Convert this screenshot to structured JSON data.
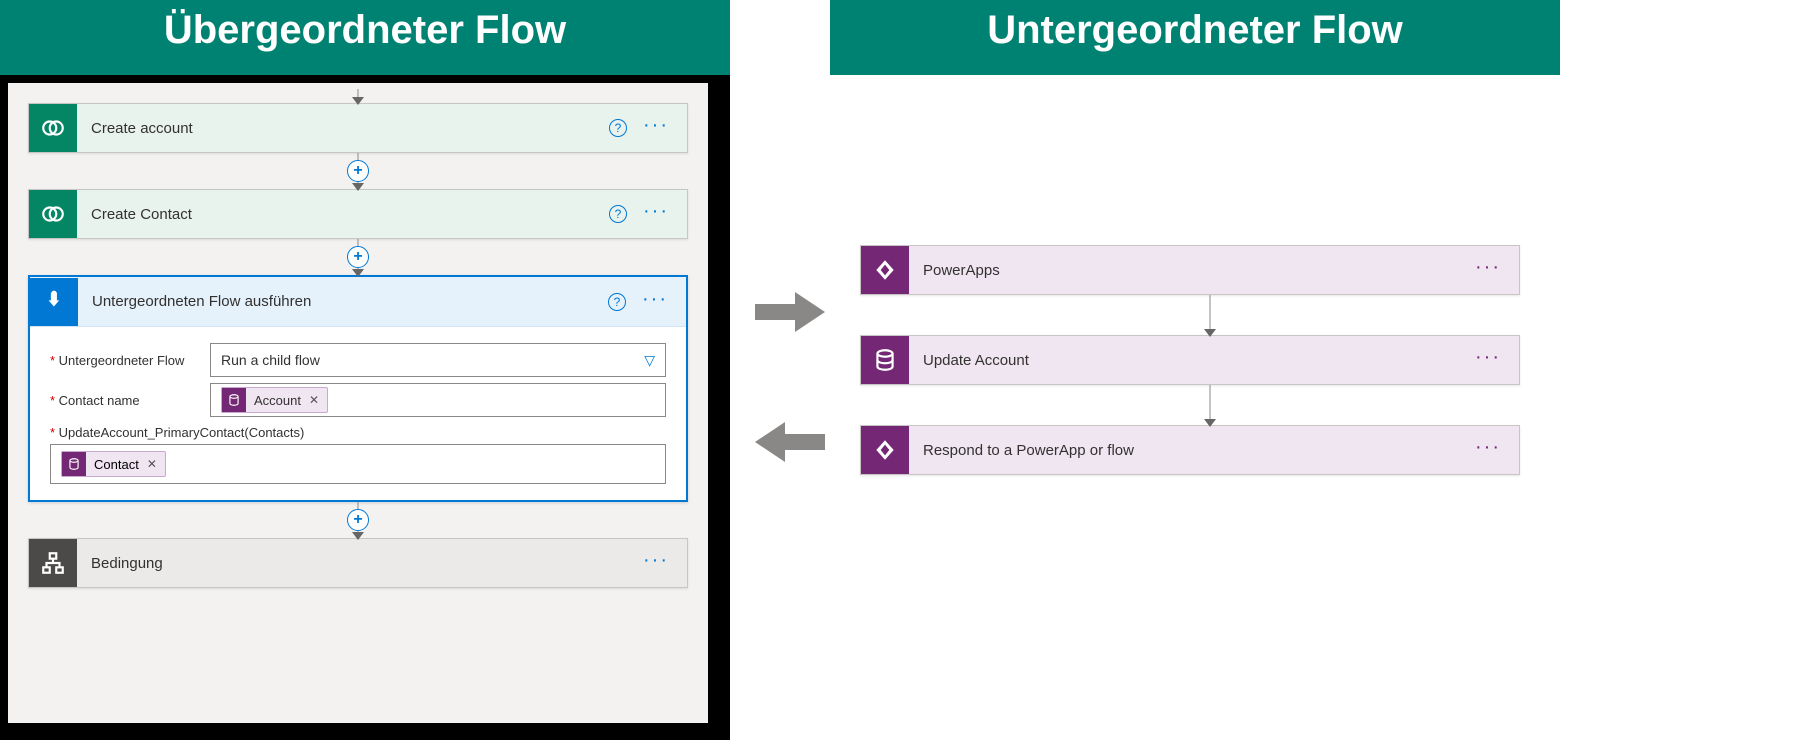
{
  "left": {
    "title": "Übergeordneter Flow",
    "steps": {
      "create_account": "Create account",
      "create_contact": "Create Contact",
      "run_child": "Untergeordneten Flow ausführen",
      "condition": "Bedingung"
    },
    "child_form": {
      "field_flow_label": "Untergeordneter Flow",
      "field_flow_value": "Run a child flow",
      "field_contact_label": "Contact name",
      "token_account": "Account",
      "field_update_label": "UpdateAccount_PrimaryContact(Contacts)",
      "token_contact": "Contact"
    }
  },
  "right": {
    "title": "Untergeordneter Flow",
    "steps": {
      "powerapps": "PowerApps",
      "update_account": "Update Account",
      "respond": "Respond to a PowerApp or flow"
    }
  }
}
